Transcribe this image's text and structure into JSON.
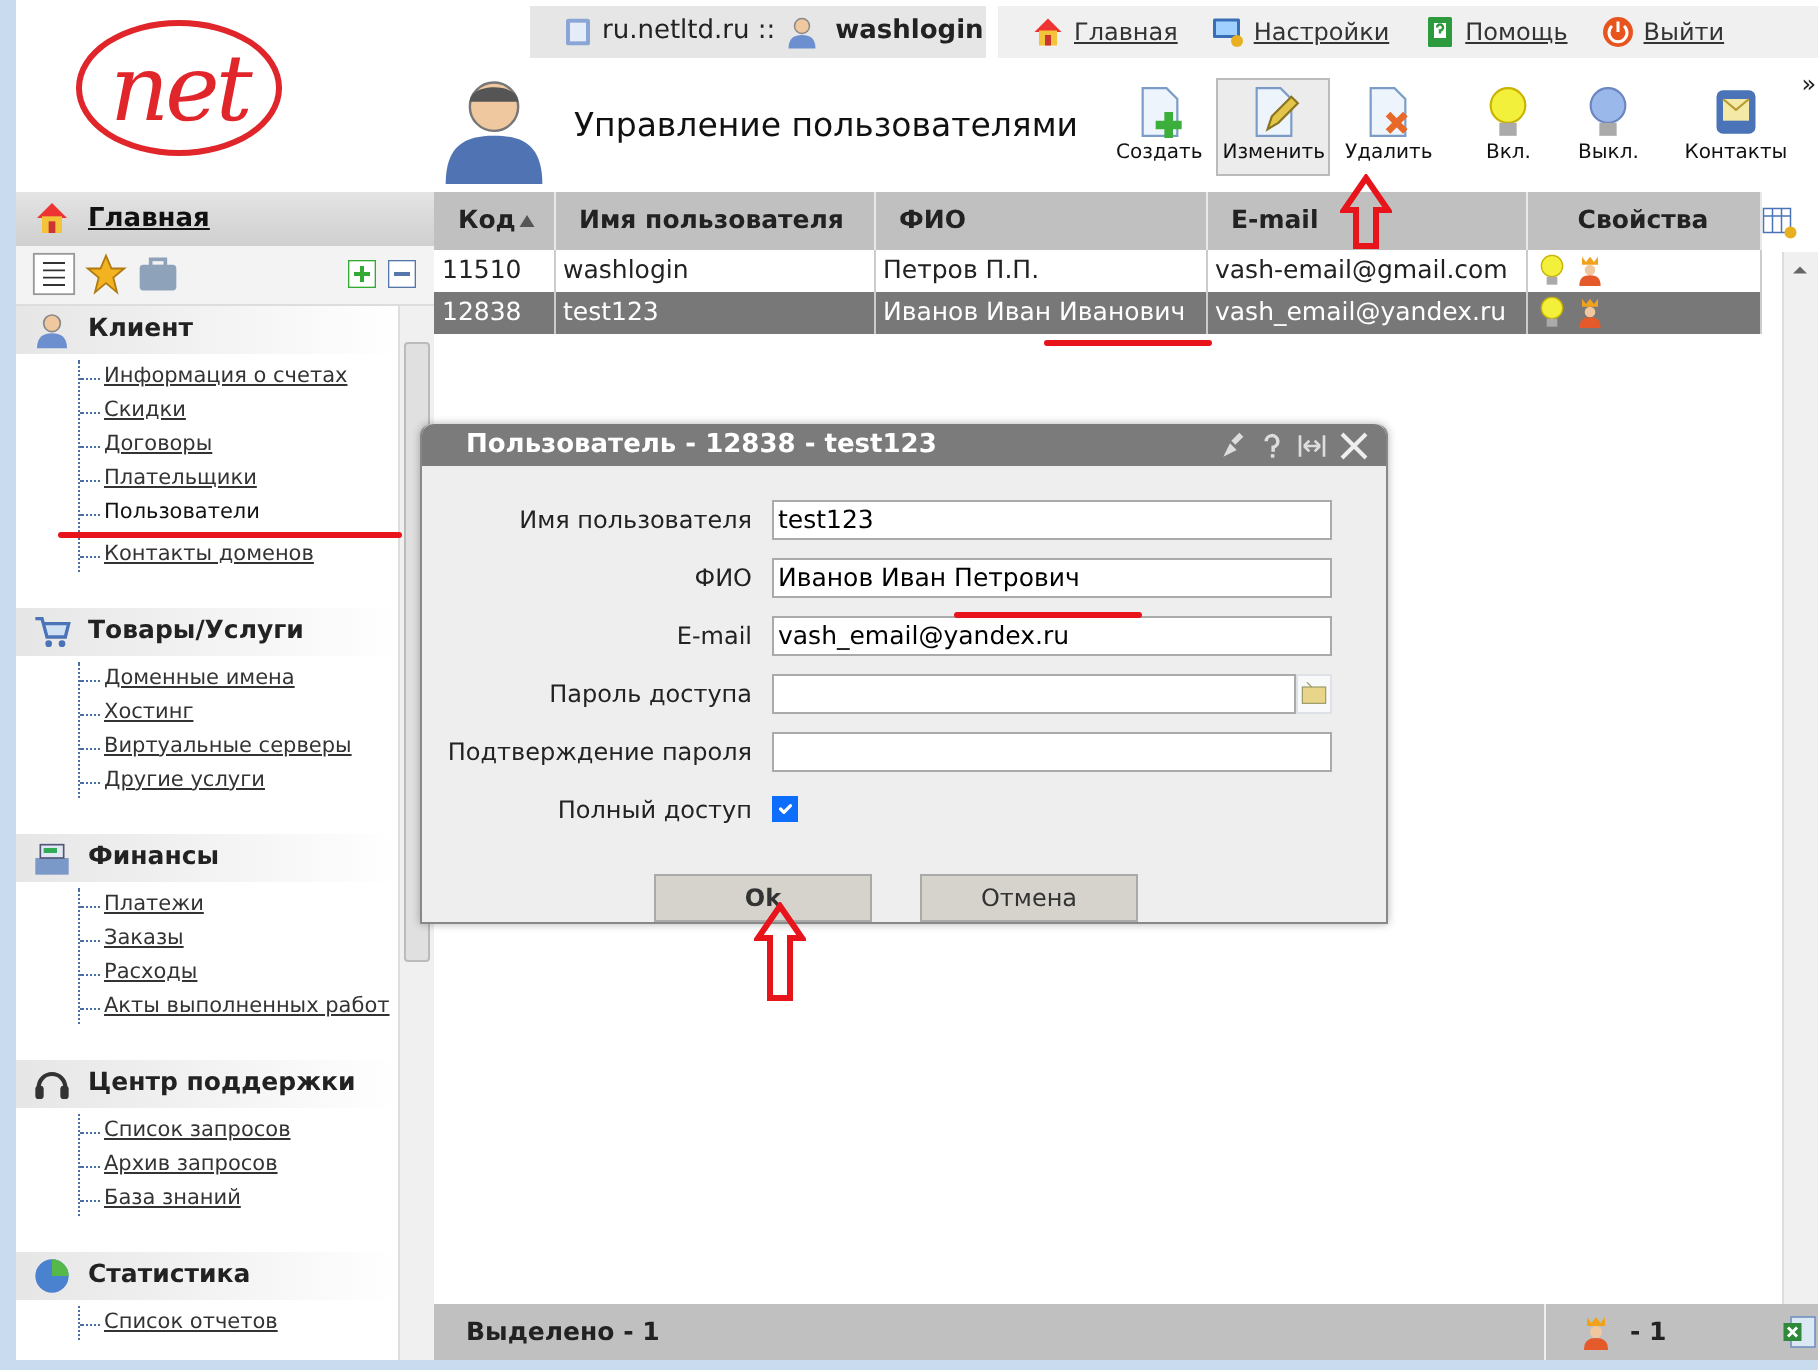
{
  "logo": {
    "text": "net"
  },
  "top_bar": {
    "site": "ru.netltd.ru ::",
    "user": "washlogin",
    "links": [
      {
        "label": "Главная",
        "kind": "home"
      },
      {
        "label": "Настройки",
        "kind": "settings"
      },
      {
        "label": "Помощь",
        "kind": "help"
      },
      {
        "label": "Выйти",
        "kind": "logout"
      }
    ]
  },
  "page_title": "Управление пользователями",
  "toolbar": {
    "buttons": [
      {
        "label": "Создать",
        "kind": "create",
        "selected": false
      },
      {
        "label": "Изменить",
        "kind": "edit",
        "selected": true
      },
      {
        "label": "Удалить",
        "kind": "delete",
        "selected": false
      },
      {
        "label": "Вкл.",
        "kind": "bulb-on",
        "selected": false
      },
      {
        "label": "Выкл.",
        "kind": "bulb-off",
        "selected": false
      },
      {
        "label": "Контакты",
        "kind": "contacts",
        "selected": false
      }
    ],
    "more": "»"
  },
  "sidebar": {
    "home": "Главная",
    "sections": [
      {
        "title": "Клиент",
        "kind": "client",
        "items": [
          {
            "label": "Информация о счетах",
            "selected": false
          },
          {
            "label": "Скидки",
            "selected": false
          },
          {
            "label": "Договоры",
            "selected": false
          },
          {
            "label": "Плательщики",
            "selected": false
          },
          {
            "label": "Пользователи",
            "selected": true
          },
          {
            "label": "Контакты доменов",
            "selected": false
          }
        ]
      },
      {
        "title": "Товары/Услуги",
        "kind": "cart",
        "items": [
          {
            "label": "Доменные имена",
            "selected": false
          },
          {
            "label": "Хостинг",
            "selected": false
          },
          {
            "label": "Виртуальные серверы",
            "selected": false
          },
          {
            "label": "Другие услуги",
            "selected": false
          }
        ]
      },
      {
        "title": "Финансы",
        "kind": "register",
        "items": [
          {
            "label": "Платежи",
            "selected": false
          },
          {
            "label": "Заказы",
            "selected": false
          },
          {
            "label": "Расходы",
            "selected": false
          },
          {
            "label": "Акты выполненных работ",
            "selected": false
          }
        ]
      },
      {
        "title": "Центр поддержки",
        "kind": "headset",
        "items": [
          {
            "label": "Список запросов",
            "selected": false
          },
          {
            "label": "Архив запросов",
            "selected": false
          },
          {
            "label": "База знаний",
            "selected": false
          }
        ]
      },
      {
        "title": "Статистика",
        "kind": "pie",
        "items": [
          {
            "label": "Список отчетов",
            "selected": false
          }
        ]
      }
    ]
  },
  "table": {
    "columns": [
      {
        "label": "Код",
        "sorted": true
      },
      {
        "label": "Имя пользователя",
        "sorted": false
      },
      {
        "label": "ФИО",
        "sorted": false
      },
      {
        "label": "E-mail",
        "sorted": false
      },
      {
        "label": "Свойства",
        "sorted": false
      }
    ],
    "rows": [
      {
        "cells": [
          "11510",
          "washlogin",
          "Петров П.П.",
          "vash-email@gmail.com"
        ],
        "selected": false
      },
      {
        "cells": [
          "12838",
          "test123",
          "Иванов Иван Иванович",
          "vash_email@yandex.ru"
        ],
        "selected": true
      }
    ]
  },
  "dialog": {
    "title": "Пользователь - 12838 - test123",
    "fields": [
      {
        "label": "Имя пользователя",
        "kind": "text",
        "value": "test123"
      },
      {
        "label": "ФИО",
        "kind": "text",
        "value": "Иванов Иван Петрович"
      },
      {
        "label": "E-mail",
        "kind": "text",
        "value": "vash_email@yandex.ru"
      },
      {
        "label": "Пароль доступа",
        "kind": "password"
      },
      {
        "label": "Подтверждение пароля",
        "kind": "text"
      },
      {
        "label": "Полный доступ",
        "kind": "checkbox",
        "checked": true
      }
    ],
    "buttons": [
      {
        "label": "Ok",
        "primary": true
      },
      {
        "label": "Отмена",
        "primary": false
      }
    ]
  },
  "status_bar": {
    "selected": "Выделено - 1",
    "count": "- 1"
  }
}
